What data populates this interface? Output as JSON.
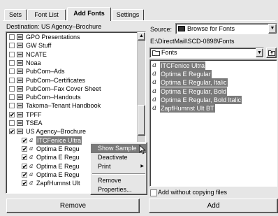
{
  "tabs": [
    "Sets",
    "Font List",
    "Add Fonts",
    "Settings"
  ],
  "active_tab": "Add Fonts",
  "destination": {
    "label": "Destination: US Agency–Brochure"
  },
  "tree": {
    "items": [
      {
        "label": "GPO Presentations",
        "checked": false
      },
      {
        "label": "GW Stuff",
        "checked": false
      },
      {
        "label": "NCATE",
        "checked": false
      },
      {
        "label": "Noaa",
        "checked": false
      },
      {
        "label": "PubCom–Ads",
        "checked": false
      },
      {
        "label": "PubCom–Certificates",
        "checked": false
      },
      {
        "label": "PubCom–Fax Cover Sheet",
        "checked": false
      },
      {
        "label": "PubCom–Handouts",
        "checked": false
      },
      {
        "label": "Takoma–Tenant Handbook",
        "checked": false
      },
      {
        "label": "TPFF",
        "checked": true
      },
      {
        "label": "TSEA",
        "checked": false
      },
      {
        "label": "US Agency–Brochure",
        "checked": true
      }
    ],
    "children": [
      {
        "label": "ITCFenice Ultra",
        "selected": true
      },
      {
        "label": "Optima E Regu"
      },
      {
        "label": "Optima E Regu"
      },
      {
        "label": "Optima E Regu"
      },
      {
        "label": "Optima E Regu"
      },
      {
        "label": "ZapfHumnst Ult"
      }
    ]
  },
  "context_menu": {
    "items": [
      {
        "label": "Show Sample",
        "highlighted": true
      },
      {
        "label": "Deactivate"
      },
      {
        "label": "Print",
        "submenu": true
      },
      {
        "label": "Remove"
      },
      {
        "label": "Properties..."
      }
    ]
  },
  "source": {
    "label": "Source:",
    "value": "Browse for Fonts",
    "path": "E:\\DirectMail\\SCD-0898\\Fonts",
    "folder": "Fonts"
  },
  "font_list": [
    "ITCFenice Ultra",
    "Optima E Regular",
    "Optima E Regular, Italic",
    "Optima E Regular, Bold",
    "Optima E Regular, Bold Italic",
    "ZapfHumnst Ult BT"
  ],
  "add_without_copying": {
    "label": "Add without copying files",
    "checked": false
  },
  "buttons": {
    "remove": "Remove",
    "add": "Add"
  },
  "glyphs": {
    "font_icon": "a",
    "folder_icon": "folder-icon",
    "up_folder_icon": "up-folder-icon",
    "check": "✔",
    "submenu_arrow": "▶",
    "arrow_up": "▲",
    "arrow_down": "▼"
  }
}
